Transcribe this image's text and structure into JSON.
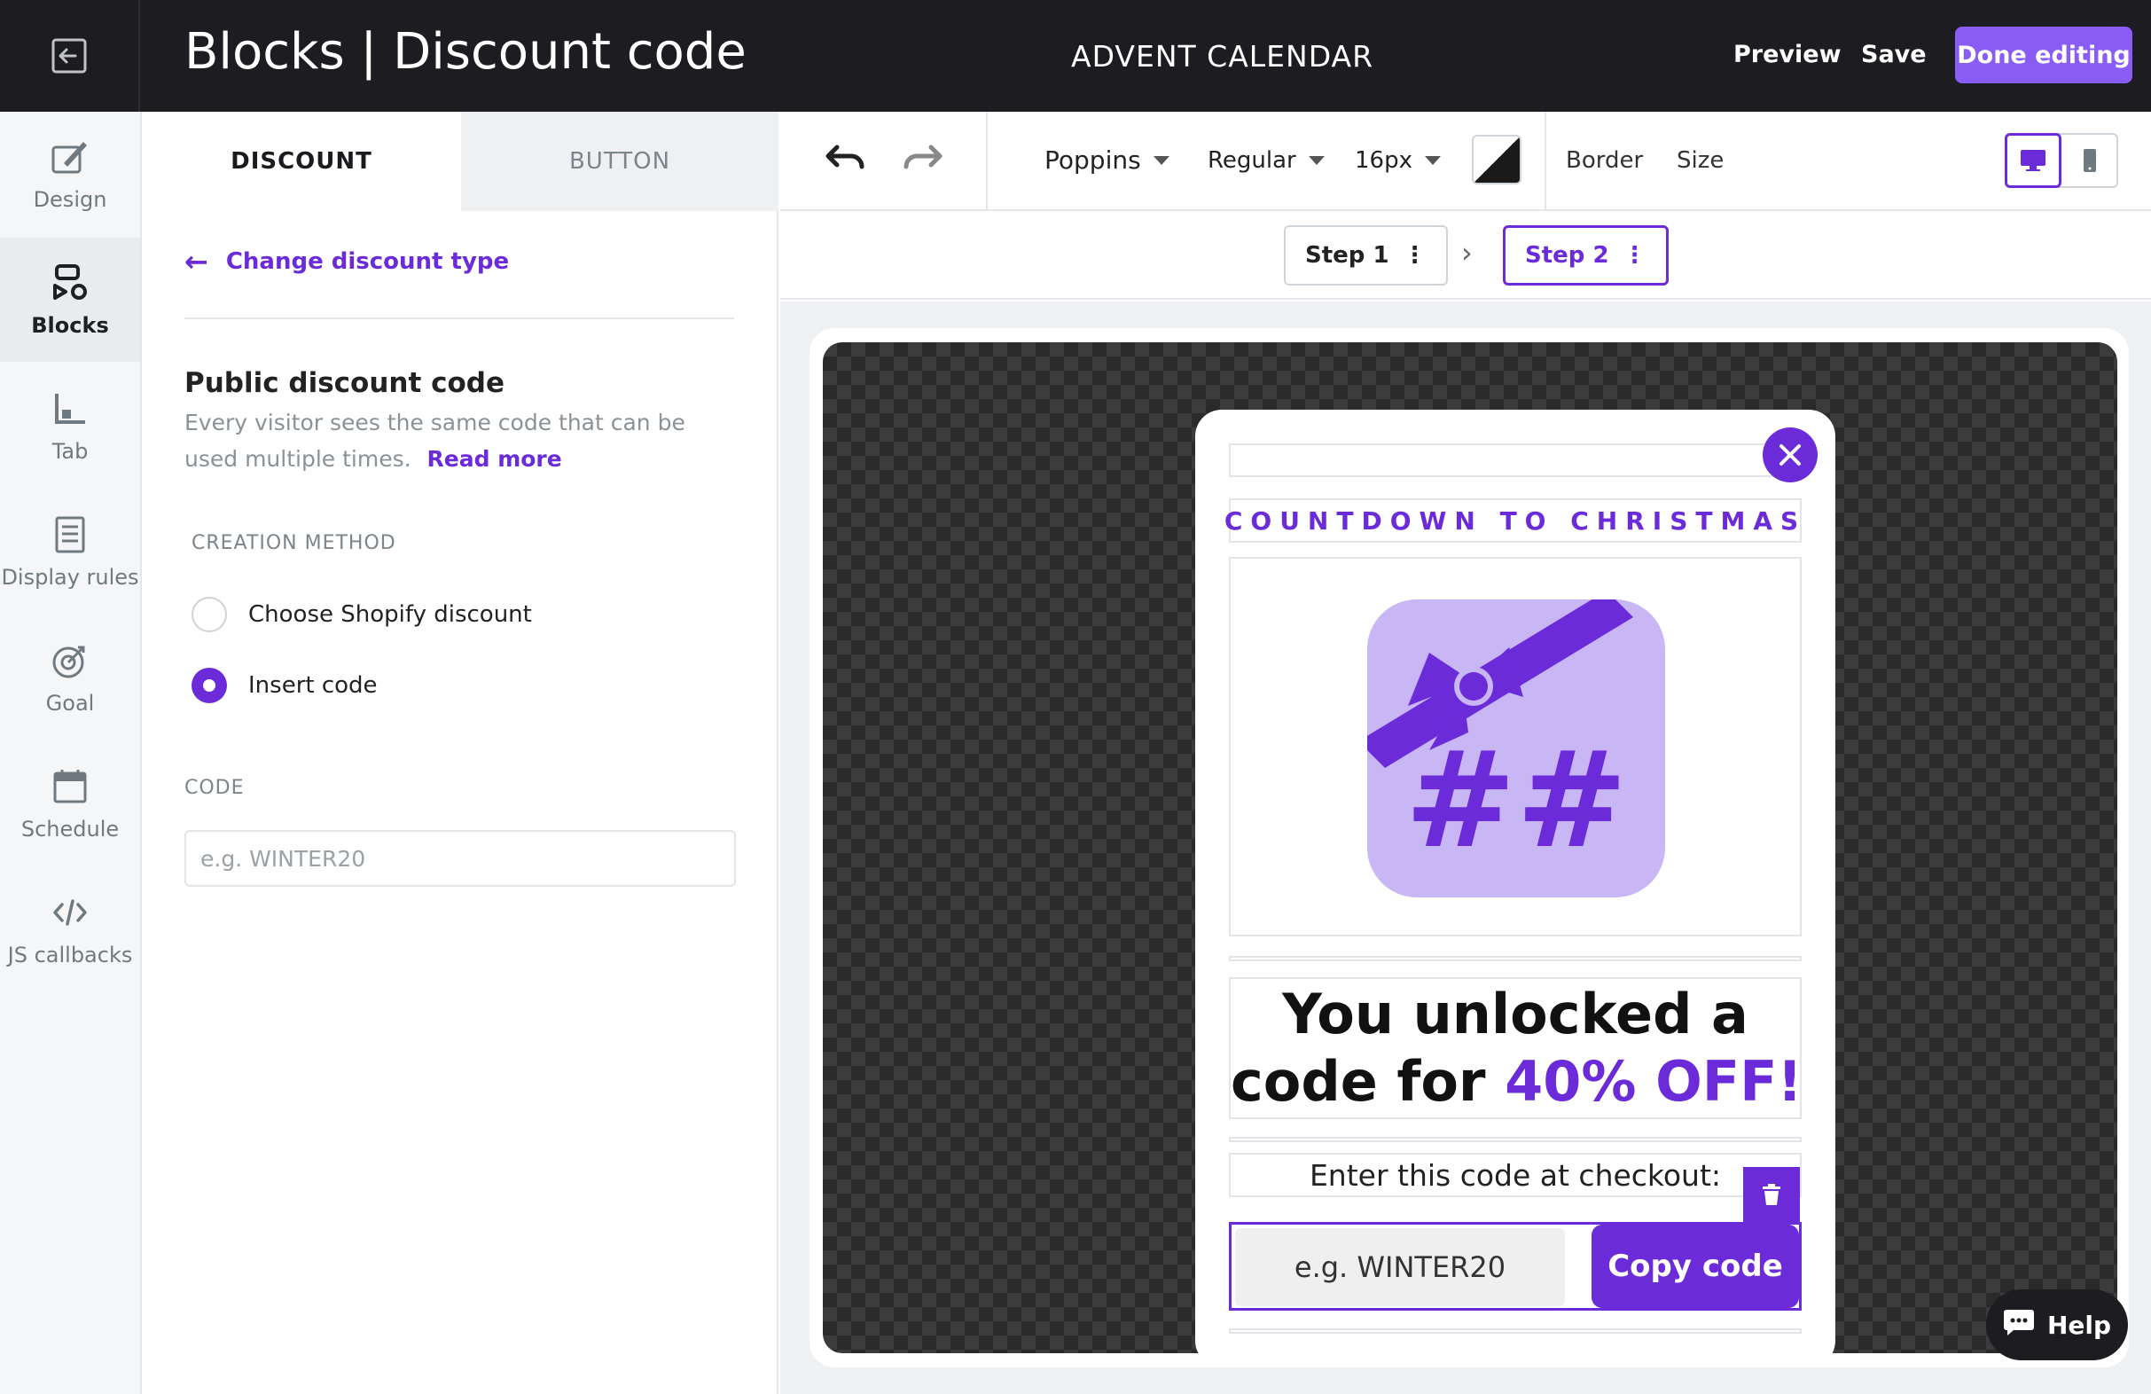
{
  "header": {
    "title": "Blocks | Discount code",
    "campaign": "ADVENT CALENDAR",
    "preview_label": "Preview",
    "save_label": "Save",
    "done_label": "Done editing",
    "exit_icon": "exit-icon"
  },
  "rail": {
    "items": [
      {
        "label": "Design",
        "icon": "paintbrush-icon"
      },
      {
        "label": "Blocks",
        "icon": "blocks-icon",
        "active": true
      },
      {
        "label": "Tab",
        "icon": "tab-icon"
      },
      {
        "label": "Display rules",
        "icon": "document-icon"
      },
      {
        "label": "Goal",
        "icon": "target-icon"
      },
      {
        "label": "Schedule",
        "icon": "calendar-icon"
      },
      {
        "label": "JS callbacks",
        "icon": "code-icon"
      }
    ]
  },
  "panel": {
    "tabs": {
      "discount": "DISCOUNT",
      "button": "BUTTON"
    },
    "change_type": "Change discount type",
    "section_title": "Public discount code",
    "section_desc": "Every visitor sees the same code that can be used multiple times.",
    "read_more": "Read more",
    "creation_label": "CREATION METHOD",
    "options": [
      {
        "label": "Choose Shopify discount",
        "checked": false
      },
      {
        "label": "Insert code",
        "checked": true
      }
    ],
    "code_label": "CODE",
    "code_placeholder": "e.g. WINTER20"
  },
  "toolbar": {
    "font": "Poppins",
    "weight": "Regular",
    "size": "16px",
    "border": "Border",
    "size_label": "Size"
  },
  "steps": {
    "step1": "Step 1",
    "step2": "Step 2",
    "dots": "⋮",
    "chevron": "›"
  },
  "popup": {
    "countdown": "COUNTDOWN TO CHRISTMAS",
    "headline_1": "You unlocked a",
    "headline_2a": "code for ",
    "headline_2b": "40% OFF!",
    "enter_code": "Enter this code at checkout:",
    "code_placeholder": "e.g. WINTER20",
    "copy_button": "Copy code"
  },
  "help": {
    "label": "Help"
  },
  "colors": {
    "accent": "#6b2bd9",
    "done_button": "#8a5cf6",
    "topbar": "#1c1c21",
    "gift_bg": "#c8b6f5"
  }
}
